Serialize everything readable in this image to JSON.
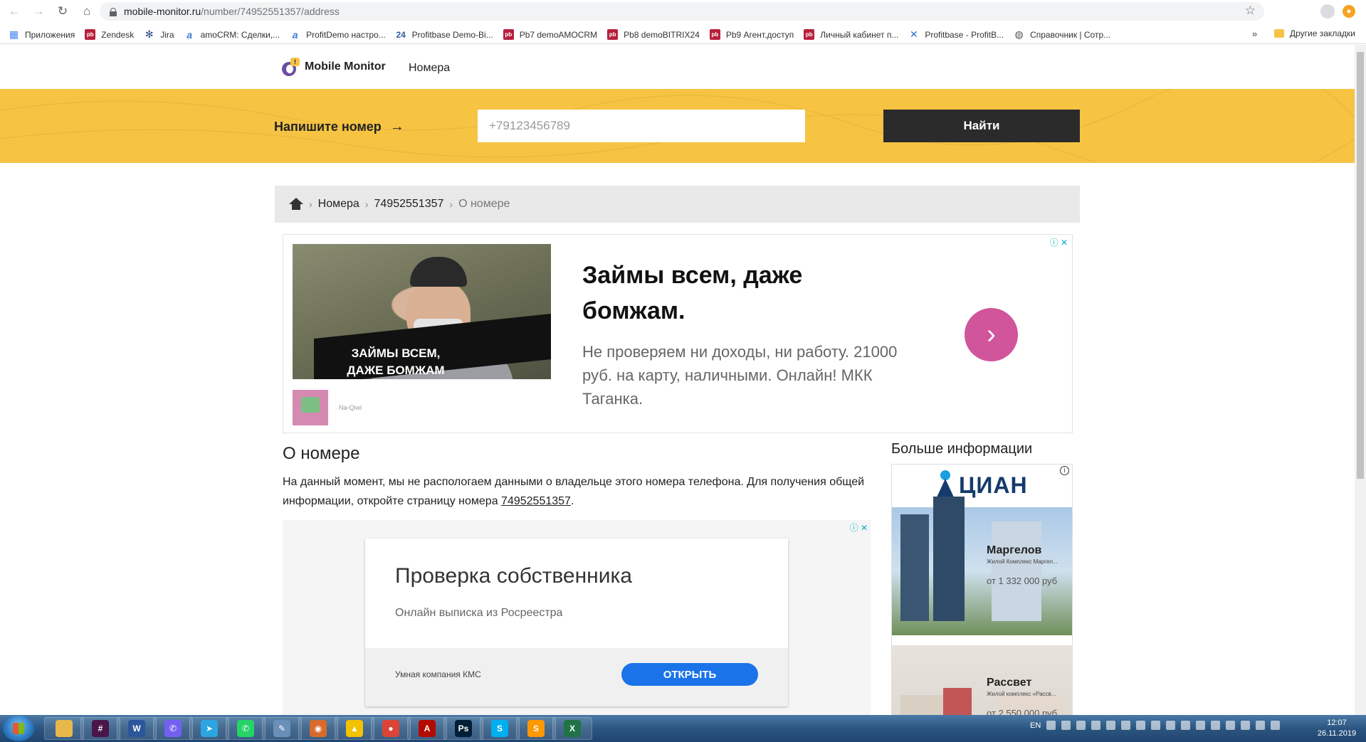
{
  "browser": {
    "url_domain": "mobile-monitor.ru",
    "url_path": "/number/74952551357/address",
    "bookmarks": [
      {
        "label": "Приложения",
        "icon": "apps-grid-icon"
      },
      {
        "label": "Zendesk",
        "icon": "pb-icon"
      },
      {
        "label": "Jira",
        "icon": "jira-icon"
      },
      {
        "label": "amoCRM: Сделки,...",
        "icon": "amocrm-icon"
      },
      {
        "label": "ProfitDemo настро...",
        "icon": "amocrm-icon"
      },
      {
        "label": "Profitbase Demo-Bi...",
        "icon": "bitrix24-icon"
      },
      {
        "label": "Pb7 demoAMOCRM",
        "icon": "pb-icon"
      },
      {
        "label": "Pb8 demoBITRIX24",
        "icon": "pb-icon"
      },
      {
        "label": "Pb9 Агент.доступ",
        "icon": "pb-icon"
      },
      {
        "label": "Личный кабинет п...",
        "icon": "pb-icon"
      },
      {
        "label": "Profitbase - ProfitB...",
        "icon": "profitbase-icon"
      },
      {
        "label": "Справочник | Сотр...",
        "icon": "globe-icon"
      }
    ],
    "more_bookmarks": "»",
    "other_bookmarks": "Другие закладки"
  },
  "site": {
    "logo_text": "Mobile Monitor",
    "nav_numbers": "Номера",
    "search_label": "Напишите номер",
    "search_placeholder": "+79123456789",
    "search_button": "Найти"
  },
  "breadcrumb": {
    "items": [
      "Номера",
      "74952551357"
    ],
    "current": "О номере",
    "separator": "›"
  },
  "ad1": {
    "image_caption_line1": "ЗАЙМЫ ВСЕМ,",
    "image_caption_line2": "ДАЖЕ БОМЖАМ",
    "advertiser": "Na-Qiwi",
    "title": "Займы всем, даже бомжам.",
    "description": "Не проверяем ни доходы, ни работу. 21000 руб. на карту, наличными. Онлайн! МКК Таганка.",
    "cta_icon": "chevron-right-icon"
  },
  "main": {
    "title": "О номере",
    "text_before_link": "На данный момент, мы не распологаем данными о владельце этого номера телефона. Для получения общей информации, откройте страницу номера ",
    "link_text": "74952551357",
    "text_after_link": "."
  },
  "ad2": {
    "title": "Проверка собственника",
    "subtitle": "Онлайн выписка из Росреестра",
    "advertiser": "Умная компания КМС",
    "button": "ОТКРЫТЬ"
  },
  "sidebar": {
    "title": "Больше информации",
    "cian_logo": "ЦИАН",
    "listings": [
      {
        "name": "Маргелов",
        "sub": "Жилой Комплекс Маргел...",
        "price": "от 1 332 000 руб"
      },
      {
        "name": "Рассвет",
        "sub": "Жилой комплекс «Рассв...",
        "price": "от 2 550 000 руб"
      }
    ]
  },
  "taskbar": {
    "apps": [
      {
        "name": "explorer",
        "color": "#e8b94a",
        "glyph": ""
      },
      {
        "name": "slack",
        "color": "#4a154b",
        "glyph": "#"
      },
      {
        "name": "word",
        "color": "#2b579a",
        "glyph": "W"
      },
      {
        "name": "viber",
        "color": "#7360f2",
        "glyph": "✆"
      },
      {
        "name": "telegram",
        "color": "#2ca5e0",
        "glyph": "➤"
      },
      {
        "name": "whatsapp",
        "color": "#25d366",
        "glyph": "✆"
      },
      {
        "name": "paint",
        "color": "#6a8fb8",
        "glyph": "✎"
      },
      {
        "name": "eye-app",
        "color": "#d86a2c",
        "glyph": "◉"
      },
      {
        "name": "archicad",
        "color": "#f2c200",
        "glyph": "▲"
      },
      {
        "name": "chrome",
        "color": "#db4437",
        "glyph": "●"
      },
      {
        "name": "acrobat",
        "color": "#b30b00",
        "glyph": "A"
      },
      {
        "name": "photoshop",
        "color": "#001e36",
        "glyph": "Ps"
      },
      {
        "name": "skype",
        "color": "#00aff0",
        "glyph": "S"
      },
      {
        "name": "sublime",
        "color": "#ff9800",
        "glyph": "S"
      },
      {
        "name": "excel",
        "color": "#217346",
        "glyph": "X"
      }
    ],
    "lang": "EN",
    "time": "12:07",
    "date": "26.11.2019"
  }
}
